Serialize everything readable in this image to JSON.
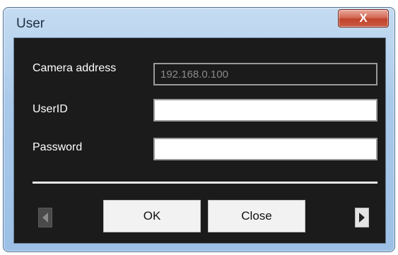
{
  "window": {
    "title": "User",
    "close_icon": "x-icon",
    "close_glyph": "X"
  },
  "form": {
    "camera_address": {
      "label": "Camera address",
      "value": "192.168.0.100"
    },
    "user_id": {
      "label": "UserID",
      "value": ""
    },
    "password": {
      "label": "Password",
      "value": ""
    }
  },
  "footer": {
    "ok_label": "OK",
    "close_label": "Close",
    "prev_icon": "arrow-left-icon",
    "next_icon": "arrow-right-icon"
  },
  "colors": {
    "title_bar": "#a9c9ea",
    "client_background": "#1b1b1b",
    "close_button": "#c0432b"
  }
}
